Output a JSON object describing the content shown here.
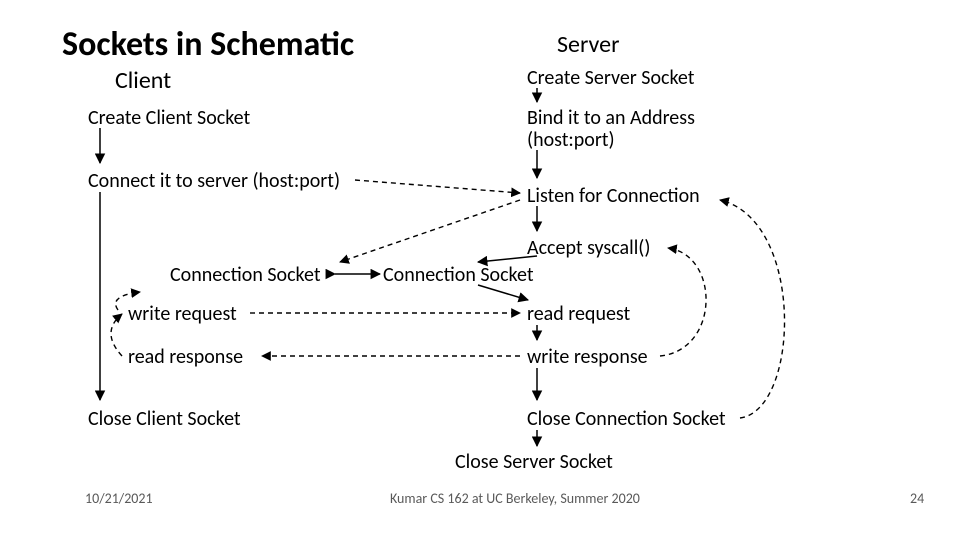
{
  "title": "Sockets in Schematic",
  "client": {
    "heading": "Client",
    "create": "Create Client Socket",
    "connect": "Connect it to server (host:port)",
    "conn_socket": "Connection Socket",
    "write_req": "write request",
    "read_resp": "read response",
    "close": "Close Client Socket"
  },
  "server": {
    "heading": "Server",
    "create": "Create Server Socket",
    "bind_l1": "Bind it to an Address",
    "bind_l2": "(host:port)",
    "listen": "Listen for Connection",
    "accept": "Accept syscall()",
    "conn_socket": "Connection Socket",
    "read_req": "read request",
    "write_resp": "write response",
    "close_conn": "Close Connection Socket",
    "close_server": "Close Server Socket"
  },
  "footer": {
    "date": "10/21/2021",
    "credit": "Kumar CS 162 at UC Berkeley, Summer 2020",
    "page": "24"
  }
}
